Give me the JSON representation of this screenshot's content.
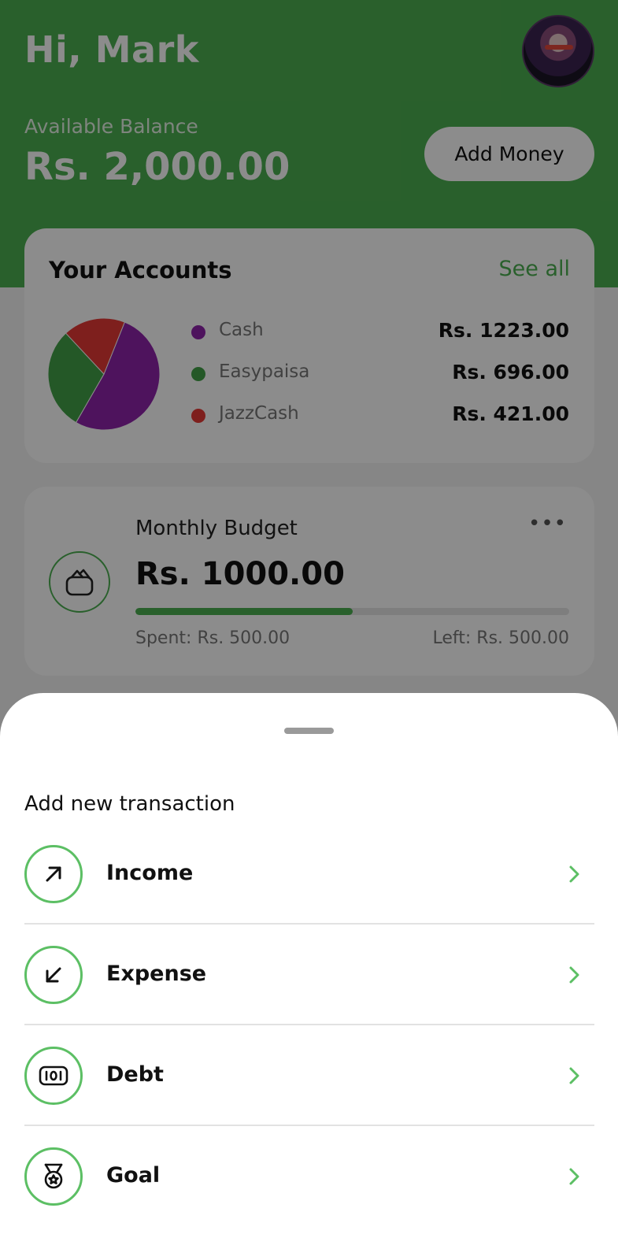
{
  "header": {
    "greeting": "Hi, Mark",
    "available_label": "Available Balance",
    "balance": "Rs. 2,000.00",
    "add_money_label": "Add Money"
  },
  "accounts": {
    "title": "Your Accounts",
    "see_all": "See all",
    "items": [
      {
        "name": "Cash",
        "amount": "Rs. 1223.00",
        "value": 1223,
        "color": "#8e24aa"
      },
      {
        "name": "Easypaisa",
        "amount": "Rs. 696.00",
        "value": 696,
        "color": "#43a047"
      },
      {
        "name": "JazzCash",
        "amount": "Rs. 421.00",
        "value": 421,
        "color": "#e53935"
      }
    ]
  },
  "budget": {
    "title": "Monthly Budget",
    "more": "•••",
    "amount": "Rs. 1000.00",
    "spent": "Spent: Rs. 500.00",
    "left": "Left: Rs. 500.00",
    "progress": 0.5,
    "icon": "wallet-icon"
  },
  "sheet": {
    "title": "Add new transaction",
    "options": [
      {
        "label": "Income",
        "icon": "arrow-up-right-icon"
      },
      {
        "label": "Expense",
        "icon": "arrow-down-left-icon"
      },
      {
        "label": "Debt",
        "icon": "money-icon"
      },
      {
        "label": "Goal",
        "icon": "medal-icon"
      }
    ]
  },
  "colors": {
    "accent": "#4caf50",
    "divider": "#e2e2e2"
  }
}
